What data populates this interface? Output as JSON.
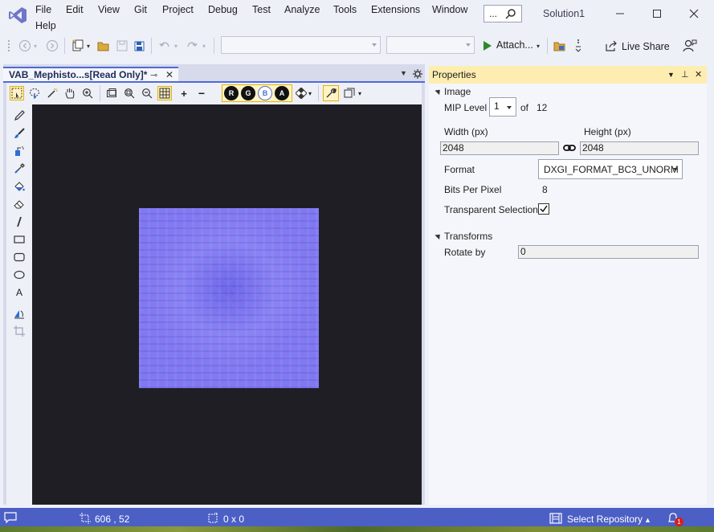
{
  "menu": {
    "items": [
      "File",
      "Edit",
      "View",
      "Git",
      "Project",
      "Debug",
      "Test",
      "Analyze",
      "Tools",
      "Extensions",
      "Window",
      "Help"
    ],
    "search_text": "...",
    "solution_name": "Solution1"
  },
  "toolbar": {
    "attach_label": "Attach...",
    "live_share_label": "Live Share"
  },
  "document": {
    "tab_title": "VAB_Mephisto...s[Read Only]*"
  },
  "editor": {
    "channels": [
      "R",
      "G",
      "B",
      "A"
    ]
  },
  "properties": {
    "title": "Properties",
    "image_section": "Image",
    "mip_level_label": "MIP Level",
    "mip_level_value": "1",
    "mip_of_label": "of",
    "mip_count": "12",
    "width_label": "Width (px)",
    "height_label": "Height (px)",
    "width_value": "2048",
    "height_value": "2048",
    "format_label": "Format",
    "format_value": "DXGI_FORMAT_BC3_UNORM",
    "bpp_label": "Bits Per Pixel",
    "bpp_value": "8",
    "transparent_label": "Transparent Selection",
    "transparent_checked": true,
    "transforms_section": "Transforms",
    "rotate_label": "Rotate by",
    "rotate_value": "0"
  },
  "status": {
    "cursor_pos": "606 , 52",
    "selection_size": "0 x 0",
    "repo_label": "Select Repository",
    "notification_count": "1"
  },
  "colors": {
    "accent": "#4b5fc5",
    "properties_header": "#fdedb0",
    "canvas": "#1f1e24",
    "normal_map": "#8279f0"
  }
}
